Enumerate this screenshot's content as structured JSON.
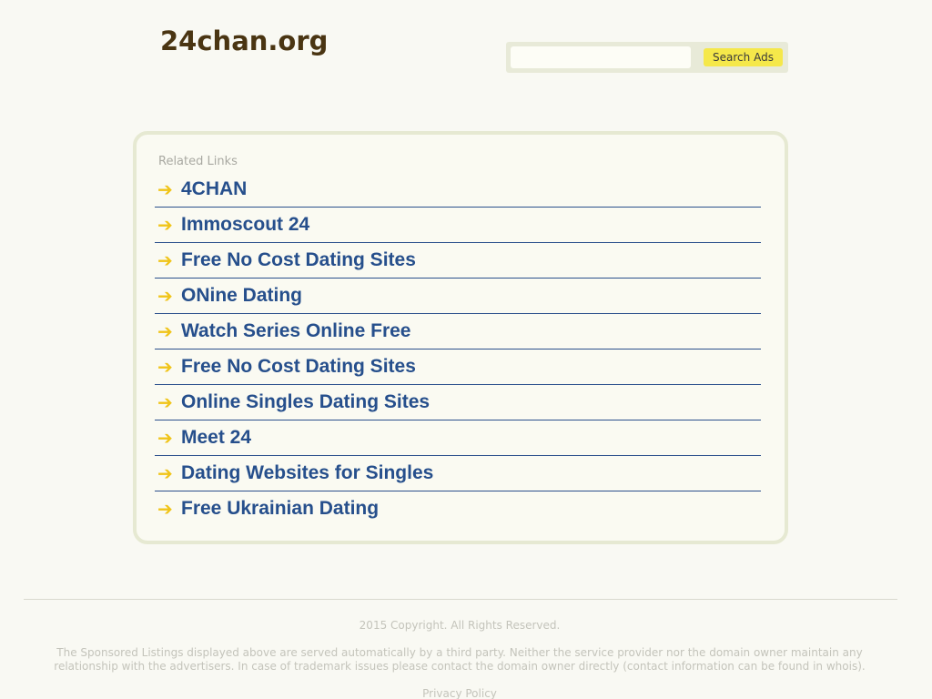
{
  "header": {
    "site_title": "24chan.org"
  },
  "search": {
    "input_value": "",
    "placeholder": "",
    "button_label": "Search Ads"
  },
  "related": {
    "title": "Related Links",
    "arrow_glyph": "➔",
    "links": [
      {
        "label": "4CHAN"
      },
      {
        "label": "Immoscout 24"
      },
      {
        "label": "Free No Cost Dating Sites"
      },
      {
        "label": "ONine Dating"
      },
      {
        "label": "Watch Series Online Free"
      },
      {
        "label": "Free No Cost Dating Sites"
      },
      {
        "label": "Online Singles Dating Sites"
      },
      {
        "label": "Meet 24"
      },
      {
        "label": "Dating Websites for Singles"
      },
      {
        "label": "Free Ukrainian Dating"
      }
    ]
  },
  "footer": {
    "copyright": "2015 Copyright. All Rights Reserved.",
    "disclaimer": "The Sponsored Listings displayed above are served automatically by a third party. Neither the service provider nor the domain owner maintain any relationship with the advertisers. In case of trademark issues please contact the domain owner directly (contact information can be found in whois).",
    "privacy_label": "Privacy Policy"
  },
  "colors": {
    "background": "#f9f9f3",
    "title": "#4a3512",
    "link": "#264f8c",
    "arrow": "#f0c419",
    "search_button": "#f5e84a",
    "box_border": "#e6e9d2"
  }
}
